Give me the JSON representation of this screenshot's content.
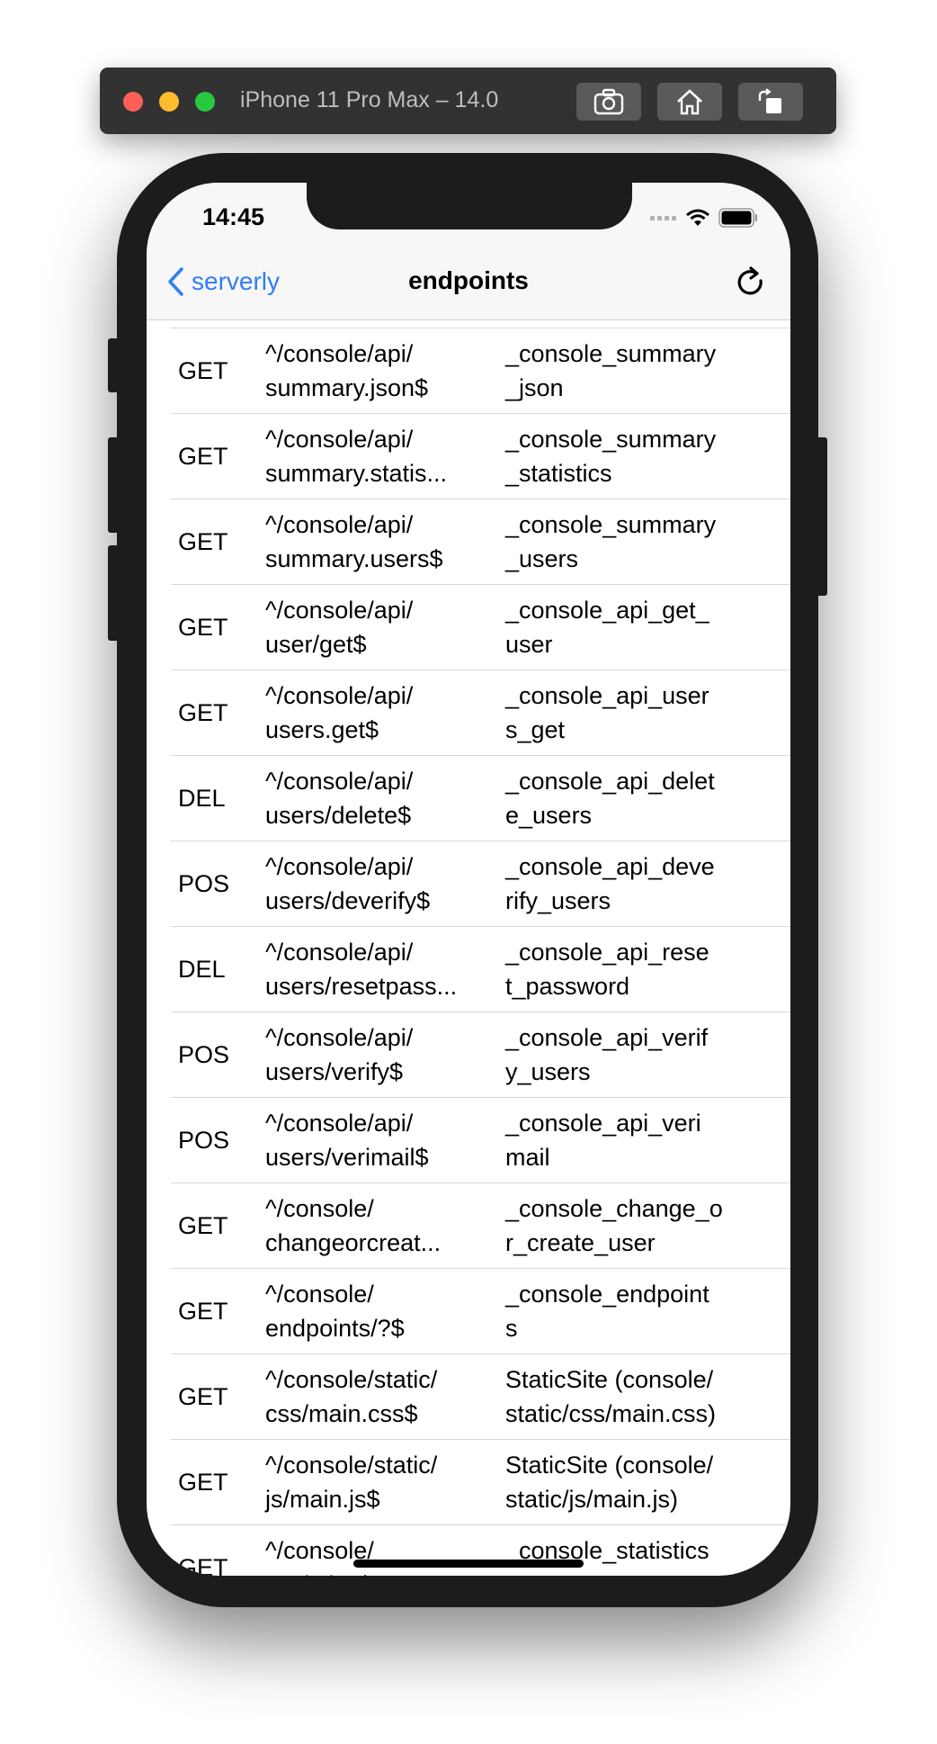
{
  "simulator": {
    "title": "iPhone 11 Pro Max – 14.0",
    "buttons": [
      "screenshot",
      "home",
      "rotate"
    ]
  },
  "status_bar": {
    "time": "14:45"
  },
  "nav": {
    "back_label": "serverly",
    "title": "endpoints"
  },
  "rows": [
    {
      "method": "GET",
      "path": "^/console/api/\nsummary.json$",
      "func": "_console_summary\n_json"
    },
    {
      "method": "GET",
      "path": "^/console/api/\nsummary.statis...",
      "func": "_console_summary\n_statistics"
    },
    {
      "method": "GET",
      "path": "^/console/api/\nsummary.users$",
      "func": "_console_summary\n_users"
    },
    {
      "method": "GET",
      "path": "^/console/api/\nuser/get$",
      "func": "_console_api_get_\nuser"
    },
    {
      "method": "GET",
      "path": "^/console/api/\nusers.get$",
      "func": "_console_api_user\ns_get"
    },
    {
      "method": "DEL",
      "path": "^/console/api/\nusers/delete$",
      "func": "_console_api_delet\ne_users"
    },
    {
      "method": "POS",
      "path": "^/console/api/\nusers/deverify$",
      "func": "_console_api_deve\nrify_users"
    },
    {
      "method": "DEL",
      "path": "^/console/api/\nusers/resetpass...",
      "func": "_console_api_rese\nt_password"
    },
    {
      "method": "POS",
      "path": "^/console/api/\nusers/verify$",
      "func": "_console_api_verif\ny_users"
    },
    {
      "method": "POS",
      "path": "^/console/api/\nusers/verimail$",
      "func": "_console_api_veri\nmail"
    },
    {
      "method": "GET",
      "path": "^/console/\nchangeorcreat...",
      "func": "_console_change_o\nr_create_user"
    },
    {
      "method": "GET",
      "path": "^/console/\nendpoints/?$",
      "func": "_console_endpoint\ns"
    },
    {
      "method": "GET",
      "path": "^/console/static/\ncss/main.css$",
      "func": "StaticSite (console/\nstatic/css/main.css)"
    },
    {
      "method": "GET",
      "path": "^/console/static/\njs/main.js$",
      "func": "StaticSite (console/\nstatic/js/main.js)"
    },
    {
      "method": "GET",
      "path": "^/console/\nstatistics$",
      "func": "_console_statistics"
    }
  ]
}
